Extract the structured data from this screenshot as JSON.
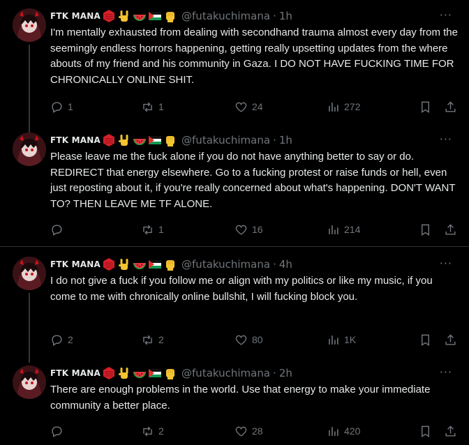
{
  "author": {
    "name": "FTK MANA",
    "handle": "@futakuchimana",
    "emojis": [
      "red-hexagon-emoji",
      "rock-hand-emoji",
      "watermelon-emoji",
      "palestine-flag-emoji",
      "raised-fist-emoji"
    ]
  },
  "tweets": [
    {
      "time": "1h",
      "text": "I'm mentally exhausted from dealing with secondhand trauma almost every day from the seemingly endless horrors happening, getting really upsetting updates from the where abouts of my friend and his community in Gaza. I DO NOT HAVE FUCKING TIME FOR CHRONICALLY ONLINE SHIT.",
      "replies": "1",
      "reposts": "1",
      "likes": "24",
      "views": "272"
    },
    {
      "time": "1h",
      "text": "Please leave me the fuck alone if you do not have anything better to say or do. REDIRECT that energy elsewhere. Go to a fucking protest or raise funds or hell, even just reposting about it,  if you're really concerned about what's happening. DON'T WANT TO? THEN LEAVE ME TF ALONE.",
      "replies": "",
      "reposts": "1",
      "likes": "16",
      "views": "214"
    },
    {
      "time": "4h",
      "text": "I do not give a fuck if you follow me or align with my politics or like my music, if you come to me with chronically online bullshit, I will fucking block you.",
      "replies": "2",
      "reposts": "2",
      "likes": "80",
      "views": "1K"
    },
    {
      "time": "2h",
      "text": "There are enough problems in the world. Use that energy to make your immediate community a better place.",
      "replies": "",
      "reposts": "2",
      "likes": "28",
      "views": "420"
    }
  ],
  "ui": {
    "separator": "·",
    "more": "···"
  },
  "colors": {
    "background": "#000000",
    "text": "#e7e9ea",
    "muted": "#71767b",
    "line": "#333639"
  }
}
